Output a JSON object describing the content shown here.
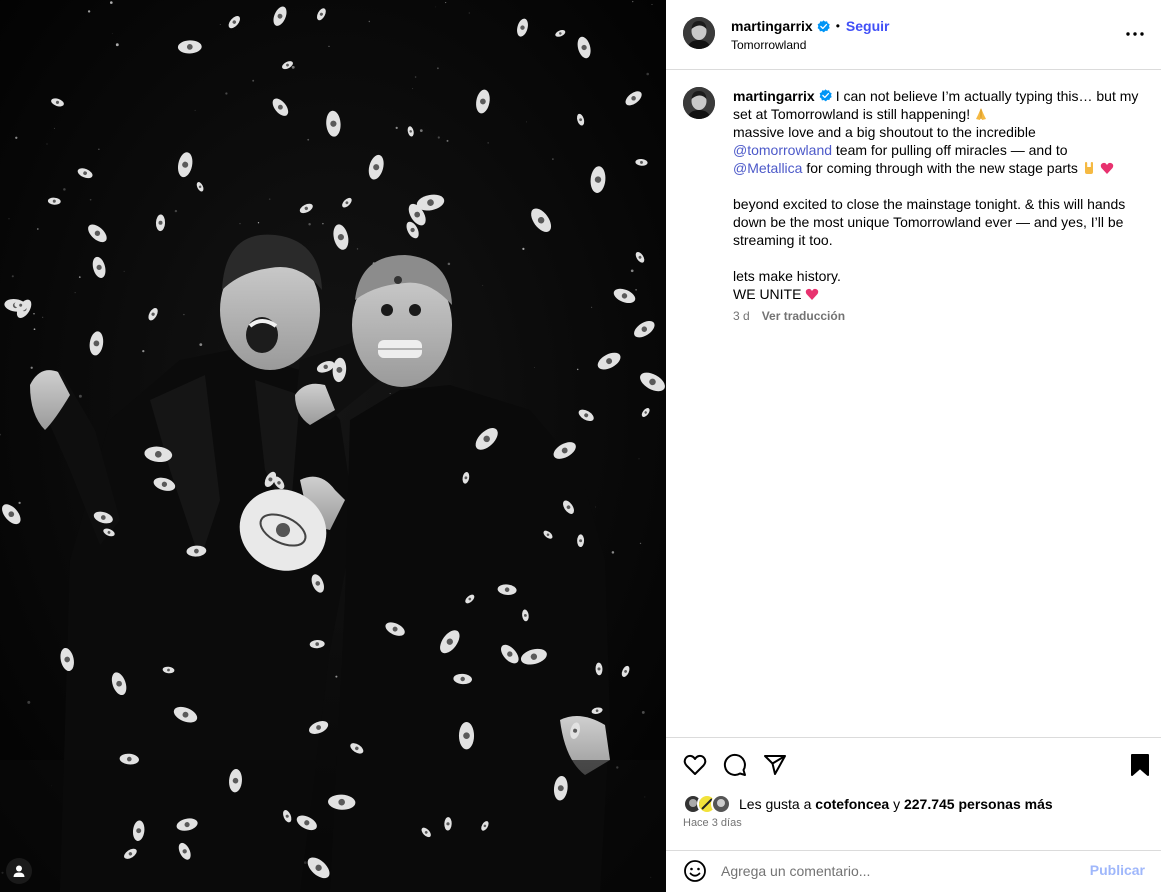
{
  "post": {
    "username": "martingarrix",
    "follow_label": "Seguir",
    "separator": "•",
    "location": "Tomorrowland",
    "caption": {
      "line1_a": "I can not believe I’m actually typing this… but my",
      "line1_b": "set at Tomorrowland is still happening!",
      "line2": "massive love and a big shoutout to the incredible",
      "mention1": "@tomorrowland",
      "line3_rest": " team for pulling off miracles — and to",
      "mention2": "@Metallica",
      "line4_rest": " for coming through with the new stage parts ",
      "para2_l1": "beyond excited to close the mainstage tonight. & this will hands",
      "para2_l2": "down be the most unique Tomorrowland ever — and yes, I’ll be",
      "para2_l3": "streaming it too.",
      "para3_l1": "lets make history.",
      "para3_l2": "WE UNITE "
    },
    "time_short": "3 d",
    "translate_label": "Ver traducción",
    "likes": {
      "prefix": "Les gusta a ",
      "first_user": "cotefoncea",
      "middle": " y ",
      "count": "227.745 personas más"
    },
    "time_long": "Hace 3 días",
    "comment_placeholder": "Agrega un comentario...",
    "publish_label": "Publicar"
  },
  "icons": {
    "like": "heart-icon",
    "comment": "comment-icon",
    "share": "paper-plane-icon",
    "save": "bookmark-icon",
    "emoji": "smiley-icon",
    "more": "more-dots-icon",
    "verified": "verified-badge-icon"
  },
  "colors": {
    "link": "#4150f7",
    "mention": "#4c59c9",
    "verified": "#0095f6",
    "publish_disabled": "#9fb7fb",
    "muted": "#737373"
  }
}
